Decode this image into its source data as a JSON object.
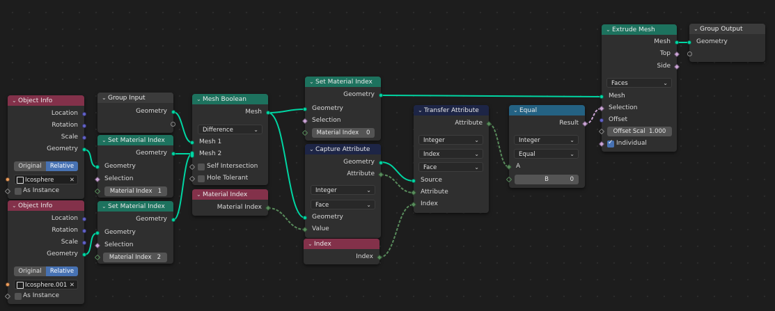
{
  "nodes": {
    "object_info_1": {
      "title": "Object Info",
      "outputs": [
        "Location",
        "Rotation",
        "Scale",
        "Geometry"
      ],
      "mode": [
        "Original",
        "Relative"
      ],
      "object": "Icosphere",
      "as_instance": "As Instance"
    },
    "object_info_2": {
      "title": "Object Info",
      "outputs": [
        "Location",
        "Rotation",
        "Scale",
        "Geometry"
      ],
      "mode": [
        "Original",
        "Relative"
      ],
      "object": "Icosphere.001",
      "as_instance": "As Instance"
    },
    "group_input": {
      "title": "Group Input",
      "geometry": "Geometry"
    },
    "set_mat_1": {
      "title": "Set Material Index",
      "out": "Geometry",
      "geometry": "Geometry",
      "selection": "Selection",
      "mat_label": "Material Index",
      "mat_value": "1"
    },
    "set_mat_2": {
      "title": "Set Material Index",
      "out": "Geometry",
      "geometry": "Geometry",
      "selection": "Selection",
      "mat_label": "Material Index",
      "mat_value": "2"
    },
    "mesh_boolean": {
      "title": "Mesh Boolean",
      "out": "Mesh",
      "operation": "Difference",
      "mesh1": "Mesh 1",
      "mesh2": "Mesh 2",
      "self_intersection": "Self Intersection",
      "hole_tolerant": "Hole Tolerant"
    },
    "material_index": {
      "title": "Material Index",
      "out": "Material Index"
    },
    "set_mat_3": {
      "title": "Set Material Index",
      "out": "Geometry",
      "geometry": "Geometry",
      "selection": "Selection",
      "mat_label": "Material Index",
      "mat_value": "0"
    },
    "capture_attribute": {
      "title": "Capture Attribute",
      "out_geometry": "Geometry",
      "out_attribute": "Attribute",
      "type": "Integer",
      "domain": "Face",
      "geometry": "Geometry",
      "value": "Value"
    },
    "index": {
      "title": "Index",
      "out": "Index"
    },
    "transfer_attribute": {
      "title": "Transfer Attribute",
      "out": "Attribute",
      "type": "Integer",
      "method": "Index",
      "domain": "Face",
      "source": "Source",
      "attribute": "Attribute",
      "index": "Index"
    },
    "equal": {
      "title": "Equal",
      "out": "Result",
      "type": "Integer",
      "op": "Equal",
      "a": "A",
      "b_label": "B",
      "b_value": "0"
    },
    "extrude_mesh": {
      "title": "Extrude Mesh",
      "out_mesh": "Mesh",
      "out_top": "Top",
      "out_side": "Side",
      "mode": "Faces",
      "mesh": "Mesh",
      "selection": "Selection",
      "offset": "Offset",
      "offset_scale_label": "Offset Scal",
      "offset_scale_value": "1.000",
      "individual": "Individual"
    },
    "group_output": {
      "title": "Group Output",
      "geometry": "Geometry"
    }
  },
  "colors": {
    "geometry": "#00d6a3",
    "integer": "#598c5c",
    "boolean": "#cca6d6",
    "vector": "#6363c7"
  }
}
